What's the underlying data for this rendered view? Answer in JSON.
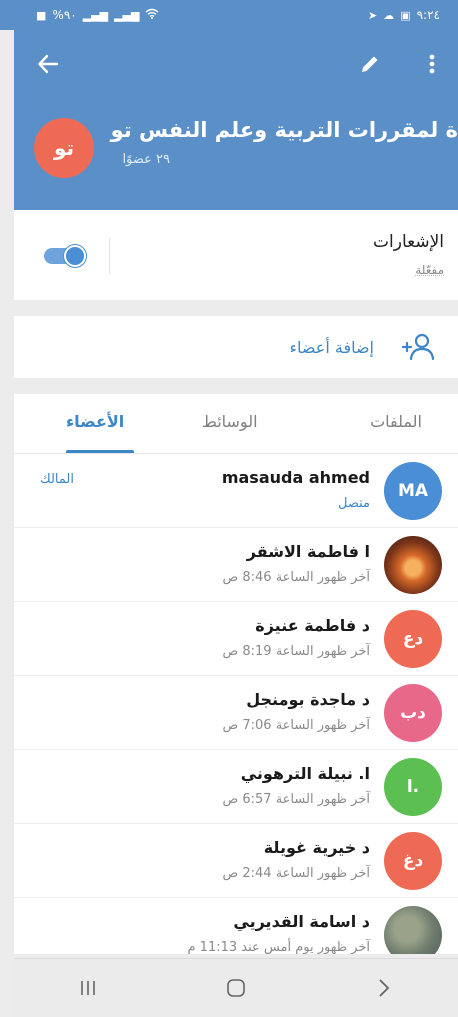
{
  "status_bar": {
    "battery": "%٩٠",
    "time": "٩:٢٤"
  },
  "group": {
    "title": "ة لمقررات التربية وعلم النفس   تو",
    "member_count": "٢٩ عضوًا",
    "avatar_initials": "تو",
    "avatar_color": "#ef6a55"
  },
  "notifications": {
    "title": "الإشعارات",
    "status": "مفعّلة",
    "enabled": true
  },
  "add_members": {
    "label": "إضافة أعضاء"
  },
  "tabs": {
    "files": "الملفات",
    "media": "الوسائط",
    "members": "الأعضاء",
    "active": "members"
  },
  "members": [
    {
      "name": "masauda ahmed",
      "status": "متصل",
      "initials": "MA",
      "color": "#4a8ed6",
      "role": "المالك"
    },
    {
      "name": "ا فاطمة الاشقر",
      "status": "آخر ظهور الساعة 8:46 ص",
      "initials": "",
      "color": ""
    },
    {
      "name": "د فاطمة عنيزة",
      "status": "آخر ظهور الساعة 8:19 ص",
      "initials": "دع",
      "color": "#ef6a55"
    },
    {
      "name": "د ماجدة بومنجل",
      "status": "آخر ظهور الساعة 7:06 ص",
      "initials": "دب",
      "color": "#e8688a"
    },
    {
      "name": "ا. نبيلة الترهوني",
      "status": "آخر ظهور الساعة 6:57 ص",
      "initials": "ا.",
      "color": "#5cbf52"
    },
    {
      "name": "د خيرية غويلة",
      "status": "آخر ظهور الساعة 2:44 ص",
      "initials": "دغ",
      "color": "#ef6a55"
    },
    {
      "name": "د اسامة القديريي",
      "status": "آخر ظهور يوم أمس عند 11:13 م",
      "initials": "",
      "color": ""
    }
  ],
  "icons": {
    "back": "arrow-left-icon",
    "edit": "pencil-icon",
    "more": "dots-vertical-icon",
    "add_member": "add-user-icon",
    "nav_recent": "recent-apps-icon",
    "nav_home": "home-icon",
    "nav_back": "back-chevron-icon"
  },
  "colors": {
    "header": "#5b8fc7",
    "accent": "#3d86c8"
  }
}
